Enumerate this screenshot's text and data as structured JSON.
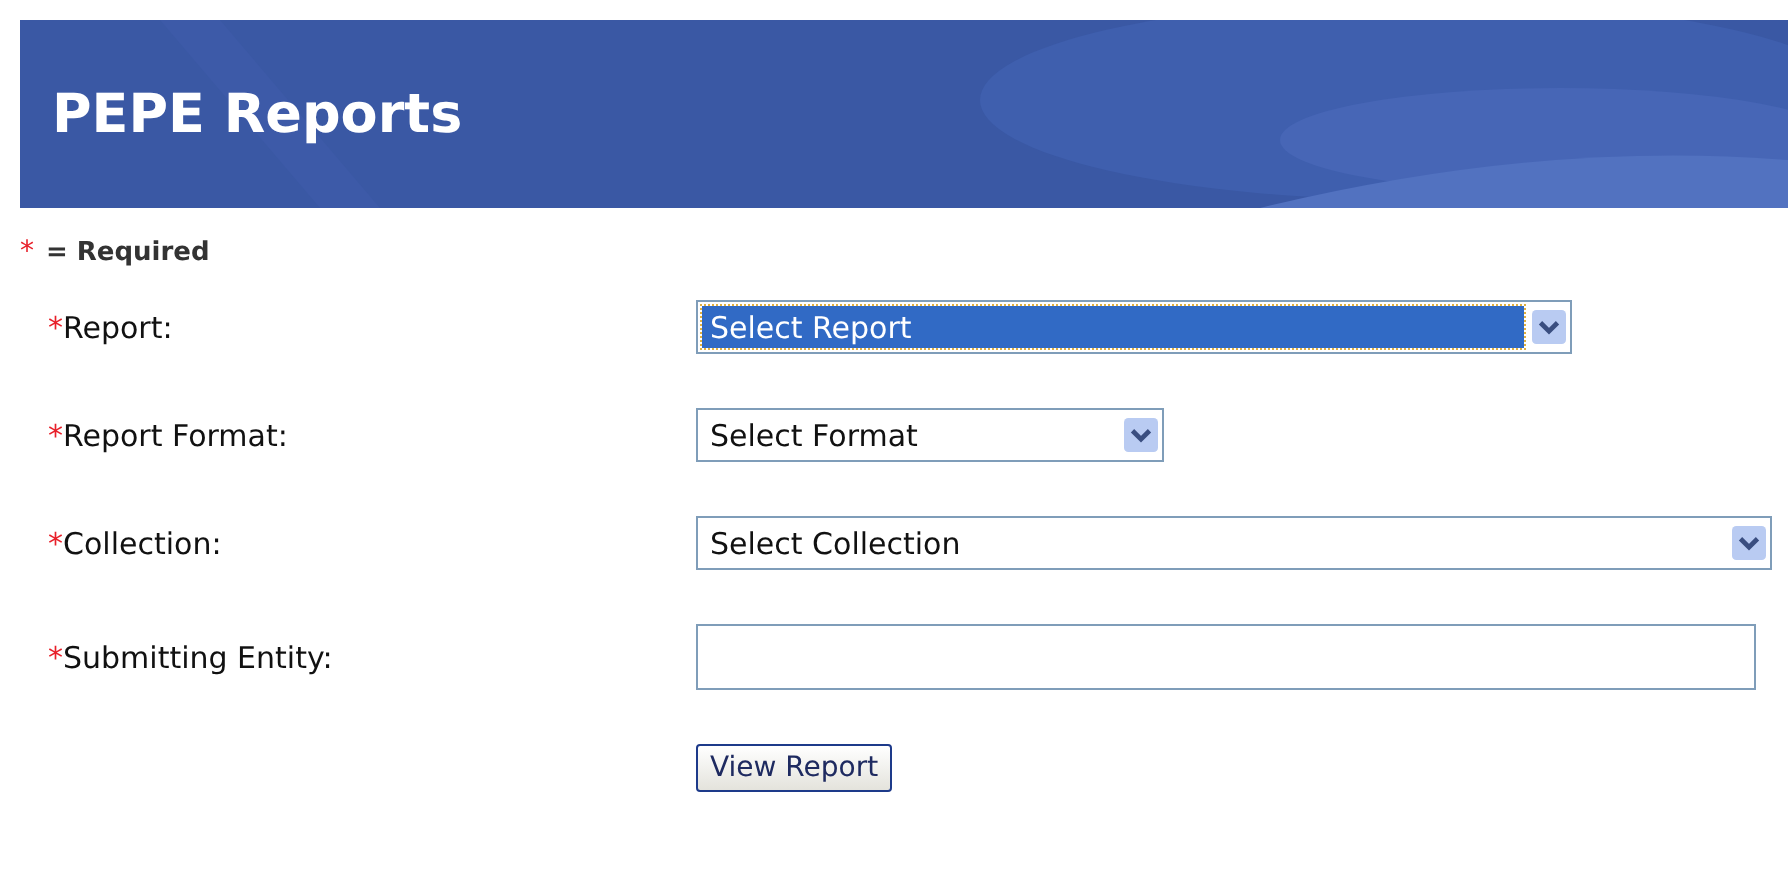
{
  "header": {
    "title": "PEPE Reports"
  },
  "legend": {
    "marker": "*",
    "text": "= Required"
  },
  "fields": [
    {
      "kind": "select",
      "marker": "*",
      "label": "Report:",
      "value": "Select Report",
      "focused": true
    },
    {
      "kind": "select",
      "marker": "*",
      "label": "Report Format:",
      "value": "Select Format",
      "focused": false
    },
    {
      "kind": "select",
      "marker": "*",
      "label": "Collection:",
      "value": "Select Collection",
      "focused": false
    },
    {
      "kind": "text",
      "marker": "*",
      "label": "Submitting Entity:",
      "focused": false
    }
  ],
  "button": {
    "label": "View Report"
  }
}
